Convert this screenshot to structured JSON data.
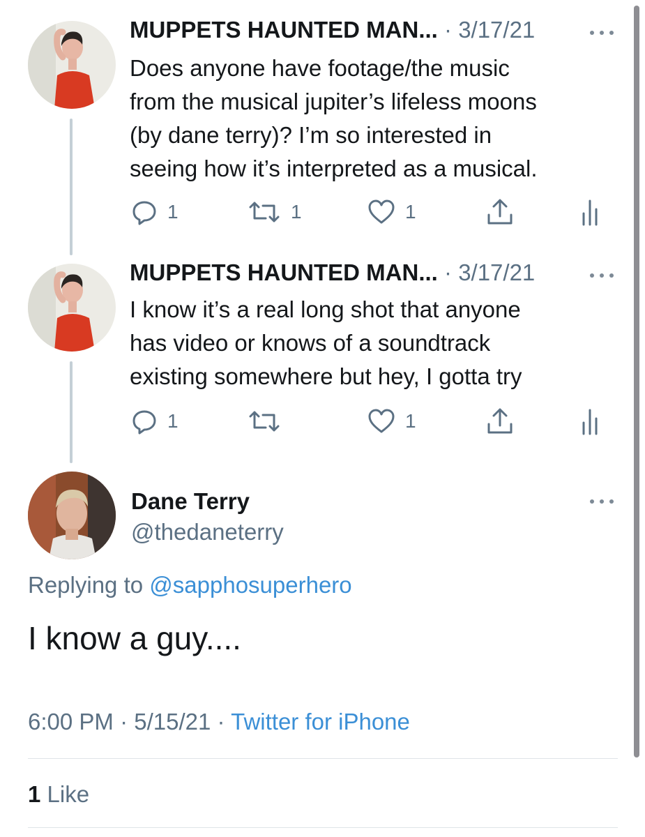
{
  "thread": [
    {
      "author_name": "MUPPETS HAUNTED MAN...",
      "separator": "·",
      "date": "3/17/21",
      "text": "Does anyone have footage/the music from the musical jupiter’s lifeless moons (by dane terry)? I’m so interested in seeing how it’s interpreted as a musical.",
      "lines": [
        "Does anyone have footage/the music",
        "from the musical jupiter’s lifeless moons",
        "(by dane terry)? I’m so interested in",
        "seeing how it’s interpreted as a musical."
      ],
      "replies": "1",
      "retweets": "1",
      "likes": "1"
    },
    {
      "author_name": "MUPPETS HAUNTED MAN...",
      "separator": "·",
      "date": "3/17/21",
      "text": "I know it’s a real long shot that anyone has video or knows of a soundtrack existing somewhere but hey, I gotta try",
      "lines": [
        "I know it’s a real long shot that anyone",
        "has video or knows of a soundtrack",
        "existing somewhere but hey, I gotta try"
      ],
      "replies": "1",
      "retweets": "",
      "likes": "1"
    }
  ],
  "main_tweet": {
    "display_name": "Dane Terry",
    "handle": "@thedaneterry",
    "replying_prefix": "Replying to",
    "replying_handle": "@sapphosuperhero",
    "text": "I know a guy....",
    "time": "6:00 PM",
    "separator": "·",
    "date": "5/15/21",
    "source": "Twitter for iPhone",
    "like_count": "1",
    "like_label": "Like"
  },
  "icons": {
    "reply": "reply-icon",
    "retweet": "retweet-icon",
    "like": "heart-icon",
    "share": "share-icon",
    "analytics": "analytics-icon",
    "more": "more-icon"
  },
  "colors": {
    "accent": "#3b8fd6",
    "muted": "#5b7083",
    "text": "#14171a",
    "thread_line": "#c4cfd6"
  }
}
